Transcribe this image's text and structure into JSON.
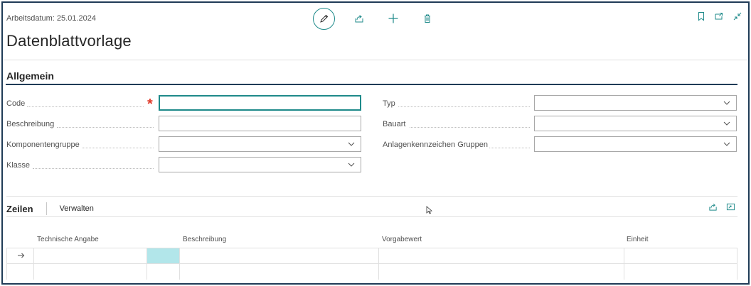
{
  "header": {
    "work_date": "Arbeitsdatum: 25.01.2024",
    "title": "Datenblattvorlage"
  },
  "toolbar": {
    "icons": [
      "pencil-icon",
      "share-icon",
      "plus-icon",
      "trash-icon"
    ],
    "right_icons": [
      "bookmark-icon",
      "open-new-window-icon",
      "collapse-icon"
    ]
  },
  "section": {
    "title": "Allgemein"
  },
  "fields": {
    "code": {
      "label": "Code",
      "value": "",
      "required": true
    },
    "beschreibung": {
      "label": "Beschreibung",
      "value": ""
    },
    "komponentengruppe": {
      "label": "Komponentengruppe",
      "value": ""
    },
    "klasse": {
      "label": "Klasse",
      "value": ""
    },
    "typ": {
      "label": "Typ",
      "value": ""
    },
    "bauart": {
      "label": "Bauart",
      "value": ""
    },
    "anlagenkennzeichen_gruppen": {
      "label": "Anlagenkennzeichen Gruppen",
      "value": ""
    }
  },
  "lines": {
    "tab_title": "Zeilen",
    "tab_manage": "Verwalten",
    "columns": [
      "Technische Angabe",
      "Beschreibung",
      "Vorgabewert",
      "Einheit"
    ],
    "rows": [
      {
        "technische_angabe": "",
        "beschreibung": "",
        "vorgabewert": "",
        "einheit": ""
      },
      {
        "technische_angabe": "",
        "beschreibung": "",
        "vorgabewert": "",
        "einheit": ""
      }
    ]
  },
  "colors": {
    "accent": "#1e8a8a",
    "header_border": "#1f3b57",
    "required": "#e03a2a",
    "selected_cell": "#b2e6ea"
  }
}
